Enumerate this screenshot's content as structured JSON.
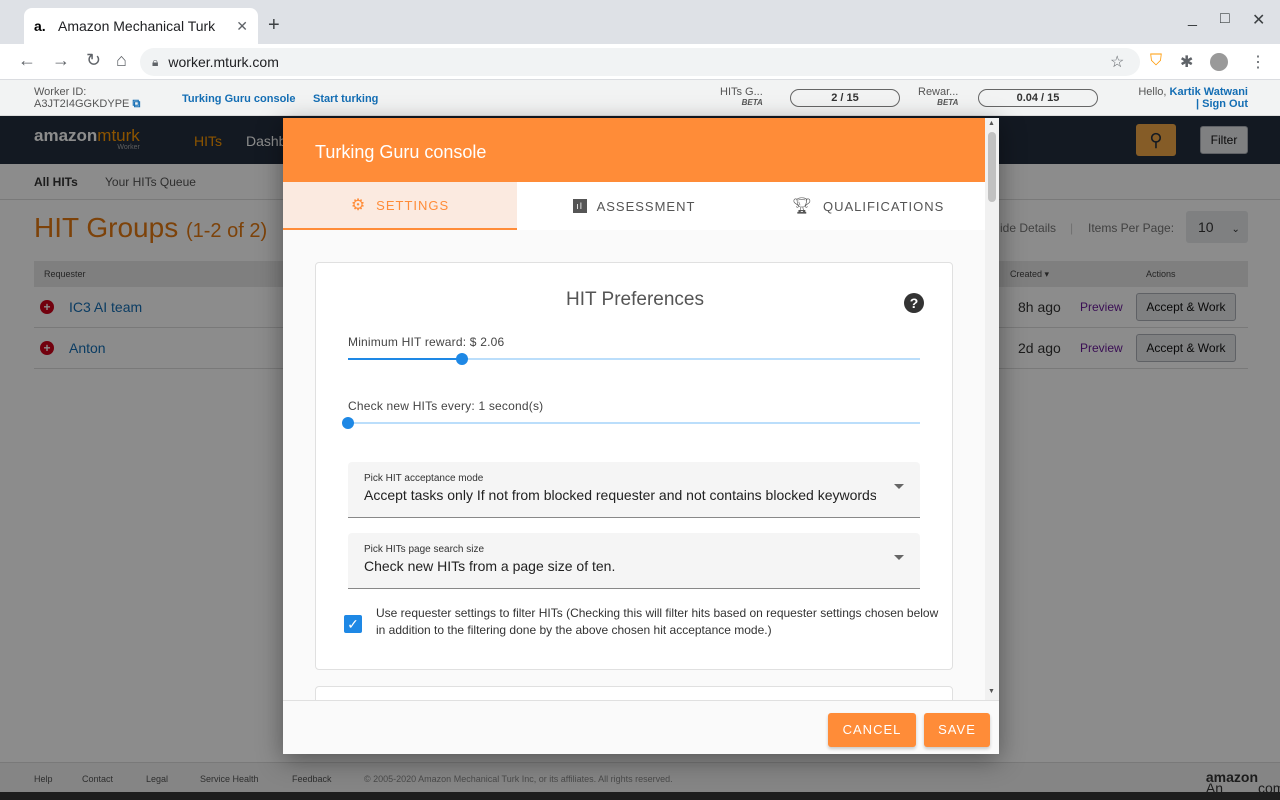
{
  "browser": {
    "tab_title": "Amazon Mechanical Turk",
    "favicon": "a.",
    "url": "worker.mturk.com",
    "window_controls": [
      "_",
      "□",
      "✕"
    ]
  },
  "topbar": {
    "worker_id_label": "Worker ID:",
    "worker_id": "A3JT2I4GGKDYPE",
    "console_link": "Turking Guru console",
    "start_link": "Start turking",
    "hits_label": "HITs G...",
    "hits_beta": "BETA",
    "hits_value": "2 / 15",
    "reward_label": "Rewar...",
    "reward_beta": "BETA",
    "reward_value": "0.04 / 15",
    "hello": "Hello,",
    "user_name": "Kartik Watwani",
    "sign_out": "| Sign Out"
  },
  "nav": {
    "logo_main": "amazon",
    "logo_accent": "mturk",
    "logo_sub": "Worker",
    "hits": "HITs",
    "dashboard": "Dashb",
    "filter": "Filter"
  },
  "subnav": {
    "all_hits": "All HITs",
    "queue": "Your HITs Queue"
  },
  "page": {
    "title": "HIT Groups",
    "count": "(1-2 of 2)",
    "hide_details": "ide Details",
    "items_per_page_label": "Items Per Page:",
    "items_per_page": "10"
  },
  "table": {
    "requester_header": "Requester",
    "created_header": "Created ▾",
    "actions_header": "Actions",
    "rows": [
      {
        "requester": "IC3 AI team",
        "created": "8h ago",
        "preview": "Preview",
        "accept": "Accept & Work"
      },
      {
        "requester": "Anton",
        "created": "2d ago",
        "preview": "Preview",
        "accept": "Accept & Work"
      }
    ]
  },
  "footer": {
    "links": [
      "Help",
      "Contact",
      "Legal",
      "Service Health",
      "Feedback"
    ],
    "copyright": "© 2005-2020 Amazon Mechanical Turk Inc, or its affiliates. All rights reserved.",
    "brand_prefix": "An",
    "brand_bold": "amazon",
    "brand_suffix": "company"
  },
  "modal": {
    "title": "Turking Guru console",
    "tabs": [
      {
        "label": "SETTINGS",
        "icon": "gear-icon"
      },
      {
        "label": "ASSESSMENT",
        "icon": "bar-chart-icon"
      },
      {
        "label": "QUALIFICATIONS",
        "icon": "trophy-icon"
      }
    ],
    "card_title": "HIT Preferences",
    "min_reward_label": "Minimum HIT reward: $ 2.06",
    "min_reward_fraction": 0.2,
    "check_every_label": "Check new HITs every: 1 second(s)",
    "check_every_fraction": 0,
    "acceptance_mode_label": "Pick HIT acceptance mode",
    "acceptance_mode_value": "Accept tasks only If not from blocked requester and not contains blocked keywords",
    "search_size_label": "Pick HITs page search size",
    "search_size_value": "Check new HITs from a page size of ten.",
    "requester_filter_checked": true,
    "requester_filter_text": "Use requester settings to filter HITs (Checking this will filter hits based on requester settings chosen below in addition to the filtering done by the above chosen hit acceptance mode.)",
    "cancel": "CANCEL",
    "save": "SAVE"
  },
  "colors": {
    "accent": "#ff8c38",
    "slider": "#1e88e5",
    "nav_bg": "#232f3e"
  }
}
